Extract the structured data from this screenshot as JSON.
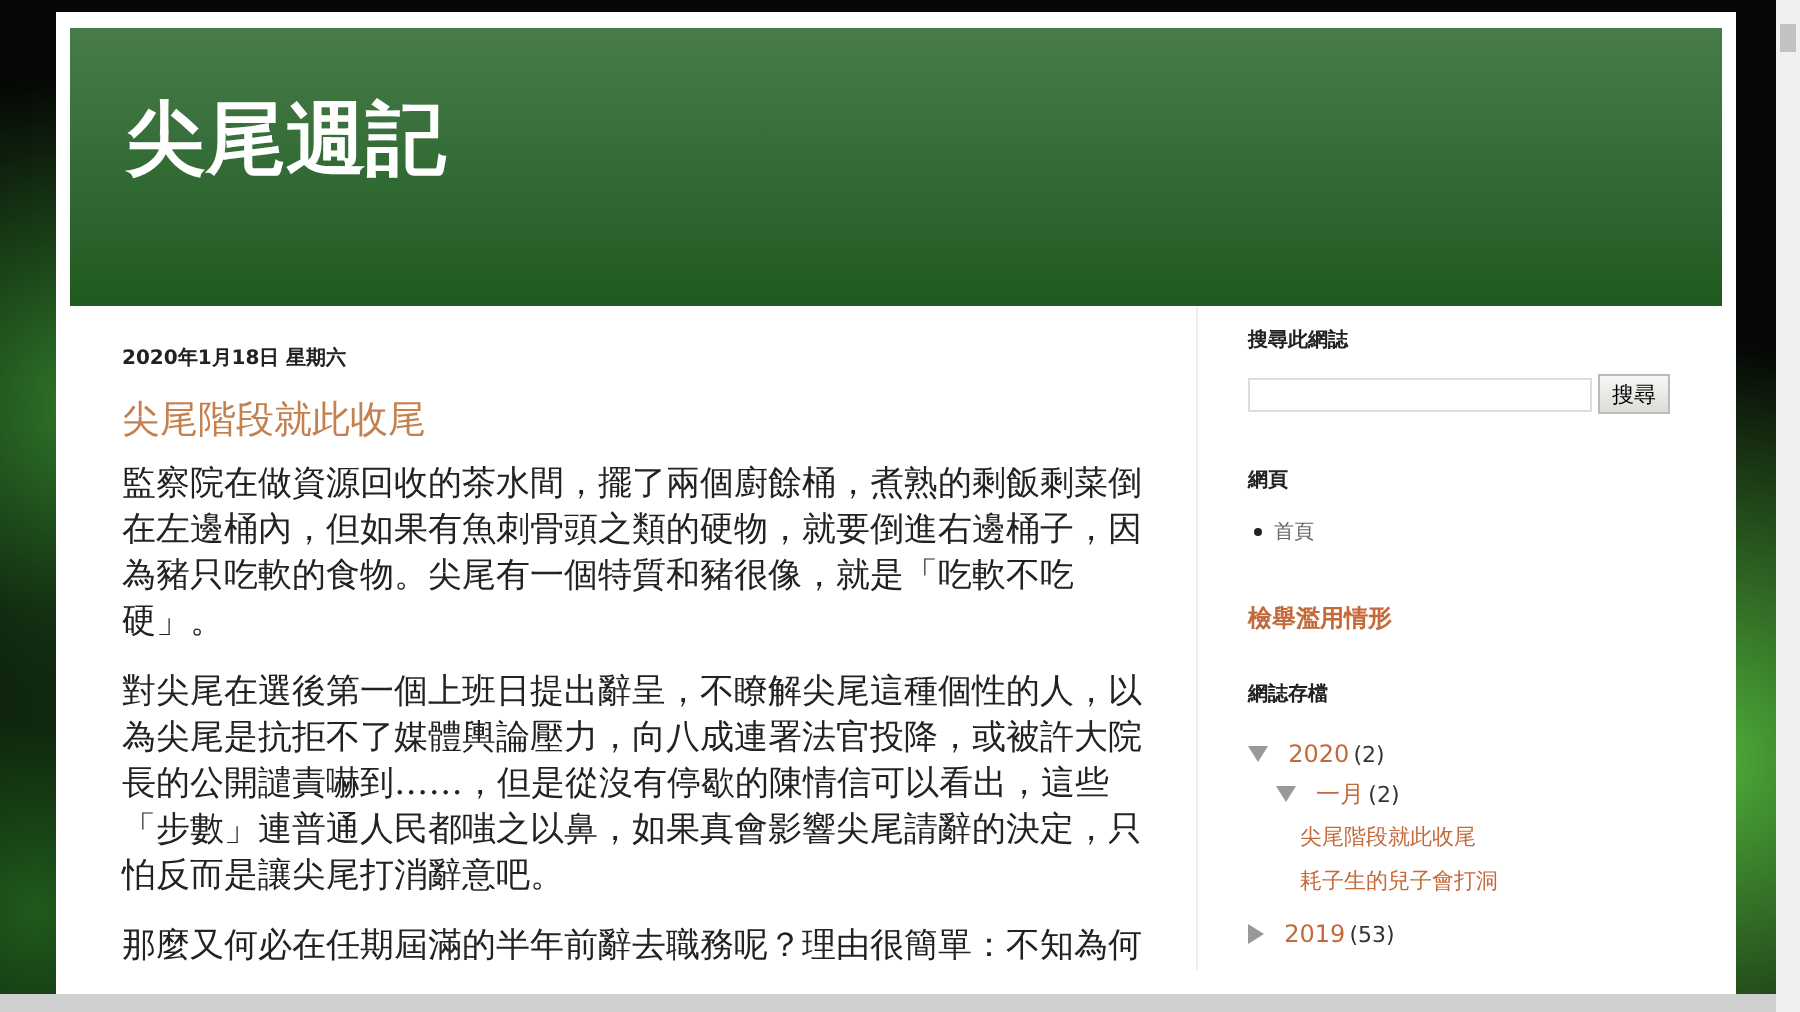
{
  "header": {
    "title": "尖尾週記"
  },
  "post": {
    "date": "2020年1月18日 星期六",
    "title": "尖尾階段就此收尾",
    "paragraphs": [
      "監察院在做資源回收的茶水間，擺了兩個廚餘桶，煮熟的剩飯剩菜倒在左邊桶內，但如果有魚刺骨頭之類的硬物，就要倒進右邊桶子，因為豬只吃軟的食物。尖尾有一個特質和豬很像，就是「吃軟不吃硬」。",
      "對尖尾在選後第一個上班日提出辭呈，不瞭解尖尾這種個性的人，以為尖尾是抗拒不了媒體輿論壓力，向八成連署法官投降，或被許大院長的公開譴責嚇到……，但是從沒有停歇的陳情信可以看出，這些「步數」連普通人民都嗤之以鼻，如果真會影響尖尾請辭的決定，只怕反而是讓尖尾打消辭意吧。",
      "那麼又何必在任期屆滿的半年前辭去職務呢？理由很簡單：不知為何"
    ]
  },
  "sidebar": {
    "search": {
      "title": "搜尋此網誌",
      "button": "搜尋"
    },
    "pages": {
      "title": "網頁",
      "items": [
        {
          "label": "首頁"
        }
      ]
    },
    "featured": {
      "title": "檢舉濫用情形"
    },
    "archive": {
      "title": "網誌存檔",
      "years": [
        {
          "label": "2020",
          "count": "(2)",
          "expanded": true,
          "children": [
            {
              "label": "一月",
              "count": "(2)",
              "expanded": true,
              "children": [
                {
                  "label": "尖尾階段就此收尾"
                },
                {
                  "label": "耗子生的兒子會打洞"
                }
              ]
            }
          ]
        },
        {
          "label": "2019",
          "count": "(53)",
          "expanded": false
        }
      ]
    }
  }
}
